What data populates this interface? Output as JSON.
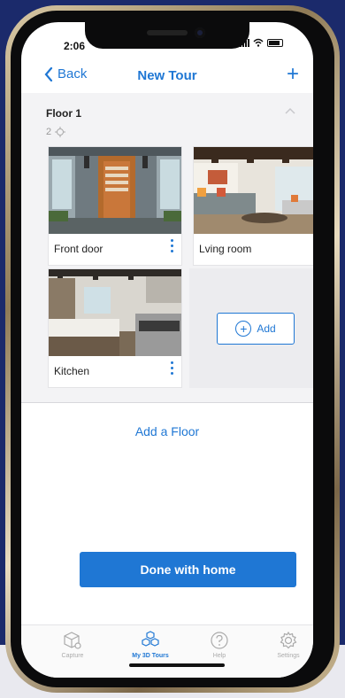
{
  "status": {
    "time": "2:06"
  },
  "nav": {
    "back_label": "Back",
    "title": "New Tour",
    "add_symbol": "+"
  },
  "floor": {
    "title": "Floor 1",
    "count": "2"
  },
  "rooms": [
    {
      "label": "Front door"
    },
    {
      "label": "Lving room"
    },
    {
      "label": "Kitchen"
    }
  ],
  "add_room": {
    "label": "Add"
  },
  "add_floor": {
    "label": "Add a Floor"
  },
  "done_button": {
    "label": "Done with home"
  },
  "tabs": [
    {
      "label": "Capture",
      "icon": "cube-capture-icon"
    },
    {
      "label": "My 3D Tours",
      "icon": "cubes-icon"
    },
    {
      "label": "Help",
      "icon": "help-icon"
    },
    {
      "label": "Settings",
      "icon": "gear-icon"
    }
  ],
  "colors": {
    "accent": "#1f77d4",
    "background": "#1b2a6b"
  }
}
